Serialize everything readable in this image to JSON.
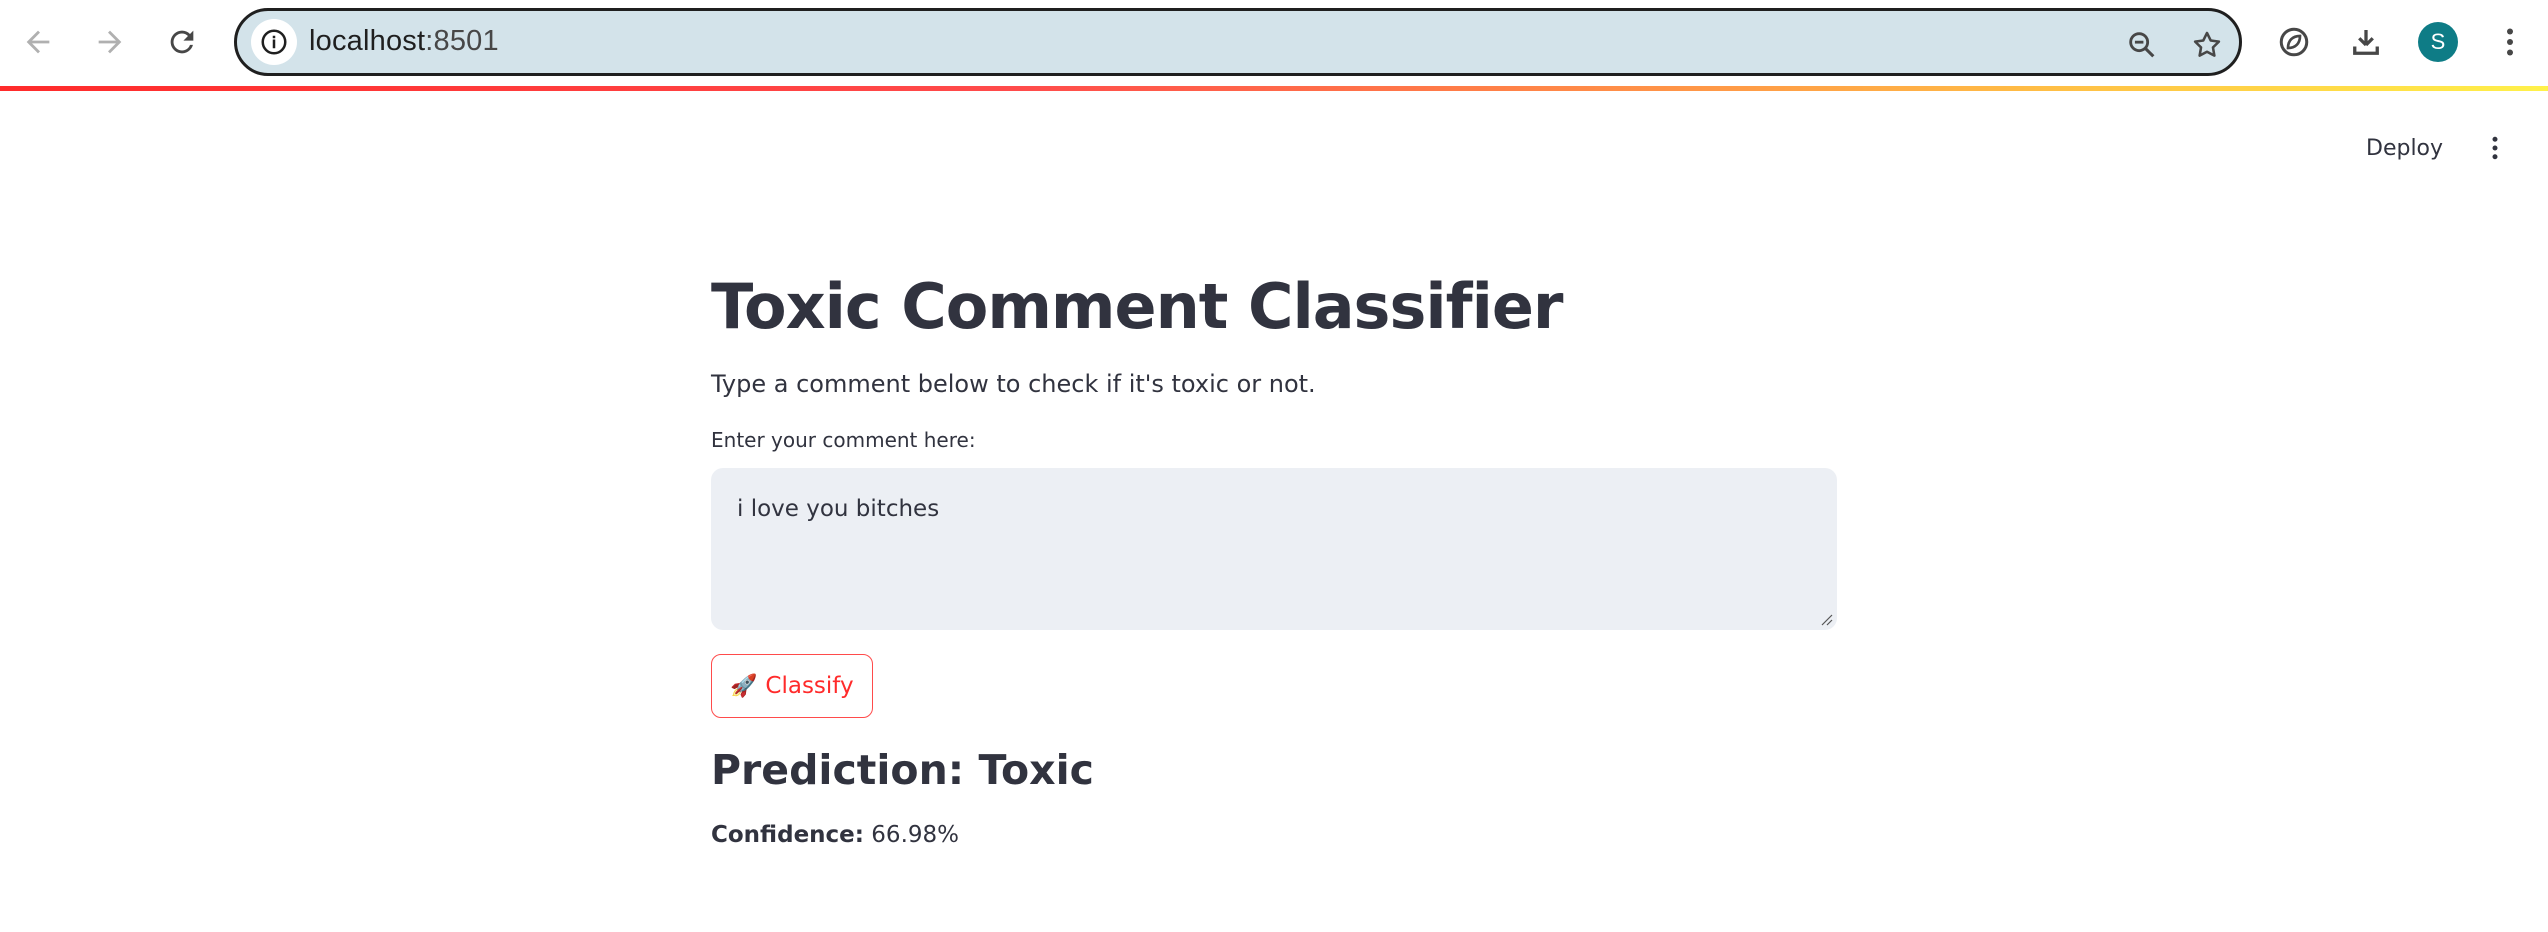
{
  "browser": {
    "url_host": "localhost",
    "url_port": ":8501",
    "profile_initial": "S",
    "profile_color": "#0e7c86"
  },
  "toolbar": {
    "deploy_label": "Deploy"
  },
  "main": {
    "title": "Toxic Comment Classifier",
    "subtitle": "Type a comment below to check if it's toxic or not.",
    "input_label": "Enter your comment here:",
    "input_value": "i love you bitches",
    "classify_icon": "🚀",
    "classify_label": "Classify",
    "prediction": "Prediction: Toxic",
    "confidence_label": "Confidence:",
    "confidence_value": "66.98%"
  },
  "colors": {
    "accent": "#ff4b4b",
    "text": "#31333f",
    "input_bg": "#eceff4",
    "omnibox_bg": "#d3e3ea"
  }
}
